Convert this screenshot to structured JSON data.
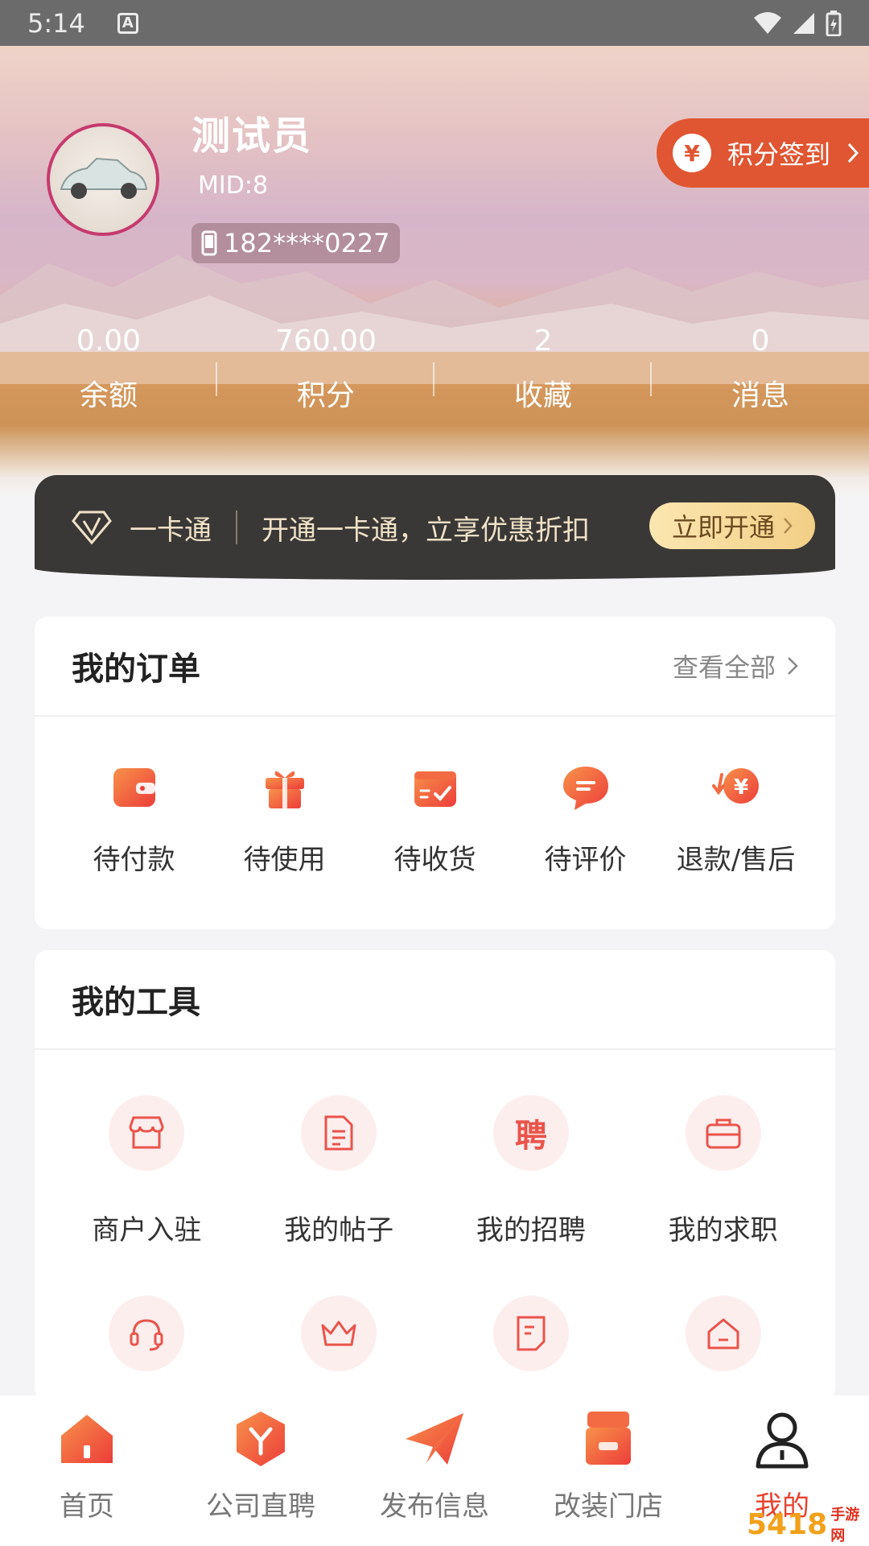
{
  "status_bar": {
    "time": "5:14",
    "a_icon": "A"
  },
  "profile": {
    "name": "测试员",
    "mid": "MID:8",
    "phone": "182****0227",
    "checkin_label": "积分签到",
    "checkin_coin": "¥",
    "avatar_caption": "is for car"
  },
  "stats": [
    {
      "value": "0.00",
      "label": "余额"
    },
    {
      "value": "760.00",
      "label": "积分"
    },
    {
      "value": "2",
      "label": "收藏"
    },
    {
      "value": "0",
      "label": "消息"
    }
  ],
  "vip": {
    "title": "一卡通",
    "desc": "开通一卡通，立享优惠折扣",
    "button": "立即开通"
  },
  "orders": {
    "title": "我的订单",
    "view_all": "查看全部",
    "items": [
      {
        "label": "待付款",
        "icon": "wallet-icon"
      },
      {
        "label": "待使用",
        "icon": "gift-icon"
      },
      {
        "label": "待收货",
        "icon": "package-check-icon"
      },
      {
        "label": "待评价",
        "icon": "chat-bubble-icon"
      },
      {
        "label": "退款/售后",
        "icon": "refund-coin-icon"
      }
    ]
  },
  "tools": {
    "title": "我的工具",
    "items": [
      {
        "label": "商户入驻",
        "icon": "store-icon"
      },
      {
        "label": "我的帖子",
        "icon": "document-icon"
      },
      {
        "label": "我的招聘",
        "icon": "hire-icon",
        "glyph": "聘"
      },
      {
        "label": "我的求职",
        "icon": "briefcase-icon"
      },
      {
        "label": "",
        "icon": "headset-icon"
      },
      {
        "label": "",
        "icon": "crown-icon"
      },
      {
        "label": "",
        "icon": "note-icon"
      },
      {
        "label": "",
        "icon": "home-icon"
      }
    ]
  },
  "nav": [
    {
      "label": "首页",
      "icon": "home-icon"
    },
    {
      "label": "公司直聘",
      "icon": "company-icon"
    },
    {
      "label": "发布信息",
      "icon": "paper-plane-icon"
    },
    {
      "label": "改装门店",
      "icon": "shop-icon"
    },
    {
      "label": "我的",
      "icon": "person-icon",
      "active": true
    }
  ],
  "watermark": {
    "text": "5418",
    "sub": "手游网"
  },
  "colors": {
    "accent": "#e8422f",
    "checkin_bg": "#e05632",
    "vip_bg": "#3a3836",
    "vip_btn": "#f2cf86",
    "tool_circle": "#fdeeee",
    "tool_icon": "#e9544b"
  }
}
